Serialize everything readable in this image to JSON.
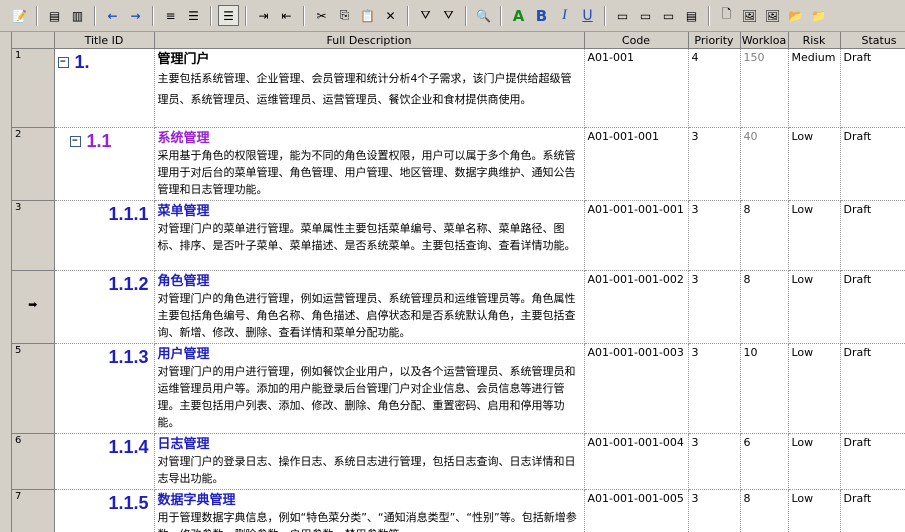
{
  "toolbar": {
    "buttons": [
      {
        "name": "properties-icon",
        "glyph": "📝"
      },
      {
        "name": "sep"
      },
      {
        "name": "insert-row-icon",
        "glyph": "▤"
      },
      {
        "name": "insert-child-icon",
        "glyph": "▥"
      },
      {
        "name": "sep"
      },
      {
        "name": "move-left-icon",
        "glyph": "←"
      },
      {
        "name": "move-right-icon",
        "glyph": "→"
      },
      {
        "name": "sep"
      },
      {
        "name": "align-lines-icon",
        "glyph": "≡"
      },
      {
        "name": "justify-lines-icon",
        "glyph": "☰"
      },
      {
        "name": "sep"
      },
      {
        "name": "wrap-text-icon",
        "glyph": "☰",
        "pressed": true
      },
      {
        "name": "sep"
      },
      {
        "name": "indent-icon",
        "glyph": "⇥"
      },
      {
        "name": "outdent-icon",
        "glyph": "⇤"
      },
      {
        "name": "sep"
      },
      {
        "name": "cut-icon",
        "glyph": "✂"
      },
      {
        "name": "copy-icon",
        "glyph": "⎘"
      },
      {
        "name": "paste-icon",
        "glyph": "📋"
      },
      {
        "name": "delete-icon",
        "glyph": "✕"
      },
      {
        "name": "sep"
      },
      {
        "name": "filter-icon",
        "glyph": "⛛"
      },
      {
        "name": "filter-clear-icon",
        "glyph": "⛛"
      },
      {
        "name": "sep"
      },
      {
        "name": "find-icon",
        "glyph": "🔍"
      },
      {
        "name": "sep"
      },
      {
        "name": "font-color-icon",
        "glyph": "A"
      },
      {
        "name": "bold-icon",
        "glyph": "B"
      },
      {
        "name": "italic-icon",
        "glyph": "I"
      },
      {
        "name": "underline-icon",
        "glyph": "U"
      },
      {
        "name": "sep"
      },
      {
        "name": "align-left-icon",
        "glyph": "▭"
      },
      {
        "name": "align-center-icon",
        "glyph": "▭"
      },
      {
        "name": "align-right-icon",
        "glyph": "▭"
      },
      {
        "name": "bullets-icon",
        "glyph": "▤"
      },
      {
        "name": "sep"
      },
      {
        "name": "new-doc-icon",
        "glyph": "🗋"
      },
      {
        "name": "image-icon",
        "glyph": "🖼"
      },
      {
        "name": "picture-icon",
        "glyph": "🖼"
      },
      {
        "name": "open-folder-icon",
        "glyph": "📂"
      },
      {
        "name": "folder-icon",
        "glyph": "📁"
      }
    ]
  },
  "columns": [
    "",
    "Title ID",
    "Full Description",
    "Code",
    "Priority",
    "Workloa",
    "Risk",
    "Status"
  ],
  "rows": [
    {
      "n": "1",
      "id": "1.",
      "level": 1,
      "toggle": "−",
      "title": "管理门户",
      "desc": "主要包括系统管理、企业管理、会员管理和统计分析4个子需求，该门户提供给超级管理员、系统管理员、运维管理员、运营管理员、餐饮企业和食材提供商使用。",
      "code": "A01-001",
      "priority": "4",
      "workload": "150",
      "workload_grey": true,
      "risk": "Medium",
      "status": "Draft",
      "h": 79
    },
    {
      "n": "2",
      "id": "1.1",
      "level": 2,
      "toggle": "−",
      "title": "系统管理",
      "desc": "采用基于角色的权限管理，能为不同的角色设置权限，用户可以属于多个角色。系统管理用于对后台的菜单管理、角色管理、用户管理、地区管理、数据字典维护、通知公告管理和日志管理功能。",
      "code": "A01-001-001",
      "priority": "3",
      "workload": "40",
      "workload_grey": true,
      "risk": "Low",
      "status": "Draft",
      "h": 70
    },
    {
      "n": "3",
      "id": "1.1.1",
      "level": 3,
      "title": "菜单管理",
      "desc": "对管理门户的菜单进行管理。菜单属性主要包括菜单编号、菜单名称、菜单路径、图标、排序、是否叶子菜单、菜单描述、是否系统菜单。主要包括查询、查看详情功能。",
      "code": "A01-001-001-001",
      "priority": "3",
      "workload": "8",
      "risk": "Low",
      "status": "Draft",
      "h": 70
    },
    {
      "n": "",
      "arrow": "➡",
      "id": "1.1.2",
      "level": 3,
      "title": "角色管理",
      "desc": "对管理门户的角色进行管理，例如运营管理员、系统管理员和运维管理员等。角色属性主要包括角色编号、角色名称、角色描述、启停状态和是否系统默认角色，主要包括查询、新增、修改、删除、查看详情和菜单分配功能。",
      "code": "A01-001-001-002",
      "priority": "3",
      "workload": "8",
      "risk": "Low",
      "status": "Draft",
      "h": 70
    },
    {
      "n": "5",
      "id": "1.1.3",
      "level": 3,
      "title": "用户管理",
      "desc": "对管理门户的用户进行管理，例如餐饮企业用户，以及各个运营管理员、系统管理员和运维管理员用户等。添加的用户能登录后台管理门户对企业信息、会员信息等进行管理。主要包括用户列表、添加、修改、删除、角色分配、重置密码、启用和停用等功能。",
      "code": "A01-001-001-003",
      "priority": "3",
      "workload": "10",
      "risk": "Low",
      "status": "Draft",
      "h": 86
    },
    {
      "n": "6",
      "id": "1.1.4",
      "level": 3,
      "title": "日志管理",
      "desc": "对管理门户的登录日志、操作日志、系统日志进行管理，包括日志查询、日志详情和日志导出功能。",
      "code": "A01-001-001-004",
      "priority": "3",
      "workload": "6",
      "risk": "Low",
      "status": "Draft",
      "h": 54
    },
    {
      "n": "7",
      "id": "1.1.5",
      "level": 3,
      "title": "数据字典管理",
      "desc": "用于管理数据字典信息，例如“特色菜分类”、“通知消息类型”、“性别”等。包括新增参数、修改参数、删除参数、启用参数、禁用参数等。",
      "code": "A01-001-001-005",
      "priority": "3",
      "workload": "8",
      "risk": "Low",
      "status": "Draft",
      "h": 60
    }
  ]
}
